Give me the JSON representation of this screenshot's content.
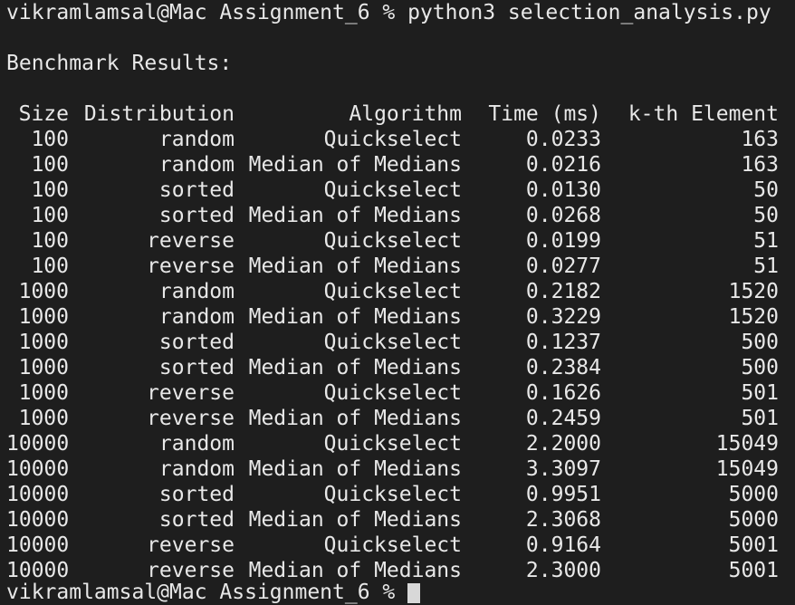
{
  "prompt": "vikramlamsal@Mac Assignment_6 % python3 selection_analysis.py",
  "heading": "Benchmark Results:",
  "columns": [
    "Size",
    "Distribution",
    "Algorithm",
    "Time (ms)",
    "k-th Element"
  ],
  "rows": [
    [
      "100",
      "random",
      "Quickselect",
      "0.0233",
      "163"
    ],
    [
      "100",
      "random",
      "Median of Medians",
      "0.0216",
      "163"
    ],
    [
      "100",
      "sorted",
      "Quickselect",
      "0.0130",
      "50"
    ],
    [
      "100",
      "sorted",
      "Median of Medians",
      "0.0268",
      "50"
    ],
    [
      "100",
      "reverse",
      "Quickselect",
      "0.0199",
      "51"
    ],
    [
      "100",
      "reverse",
      "Median of Medians",
      "0.0277",
      "51"
    ],
    [
      "1000",
      "random",
      "Quickselect",
      "0.2182",
      "1520"
    ],
    [
      "1000",
      "random",
      "Median of Medians",
      "0.3229",
      "1520"
    ],
    [
      "1000",
      "sorted",
      "Quickselect",
      "0.1237",
      "500"
    ],
    [
      "1000",
      "sorted",
      "Median of Medians",
      "0.2384",
      "500"
    ],
    [
      "1000",
      "reverse",
      "Quickselect",
      "0.1626",
      "501"
    ],
    [
      "1000",
      "reverse",
      "Median of Medians",
      "0.2459",
      "501"
    ],
    [
      "10000",
      "random",
      "Quickselect",
      "2.2000",
      "15049"
    ],
    [
      "10000",
      "random",
      "Median of Medians",
      "3.3097",
      "15049"
    ],
    [
      "10000",
      "sorted",
      "Quickselect",
      "0.9951",
      "5000"
    ],
    [
      "10000",
      "sorted",
      "Median of Medians",
      "2.3068",
      "5000"
    ],
    [
      "10000",
      "reverse",
      "Quickselect",
      "0.9164",
      "5001"
    ],
    [
      "10000",
      "reverse",
      "Median of Medians",
      "2.3000",
      "5001"
    ]
  ],
  "next_prompt": "vikramlamsal@Mac Assignment_6 % ",
  "colors": {
    "background": "#1e1e1e",
    "text": "#e8e8e8",
    "cursor": "#d8d8d8"
  }
}
